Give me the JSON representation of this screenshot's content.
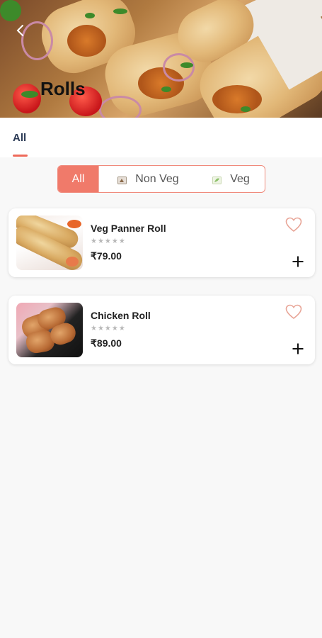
{
  "header": {
    "title": "Rolls",
    "back_icon": "chevron-left-icon"
  },
  "tabs": [
    {
      "label": "All",
      "active": true
    }
  ],
  "filter": {
    "options": [
      {
        "label": "All",
        "selected": true
      },
      {
        "label": "Non Veg",
        "icon": "non-veg-icon"
      },
      {
        "label": "Veg",
        "icon": "veg-icon"
      }
    ]
  },
  "items": [
    {
      "name": "Veg Panner Roll",
      "rating_stars": "★★★★★",
      "price": "₹79.00",
      "favorite_icon": "heart-outline-icon",
      "add_icon": "plus-icon"
    },
    {
      "name": "Chicken Roll",
      "rating_stars": "★★★★★",
      "price": "₹89.00",
      "favorite_icon": "heart-outline-icon",
      "add_icon": "plus-icon"
    }
  ],
  "colors": {
    "accent": "#f07a6a",
    "background": "#f8f8f8",
    "tab_text": "#2b3a55"
  }
}
